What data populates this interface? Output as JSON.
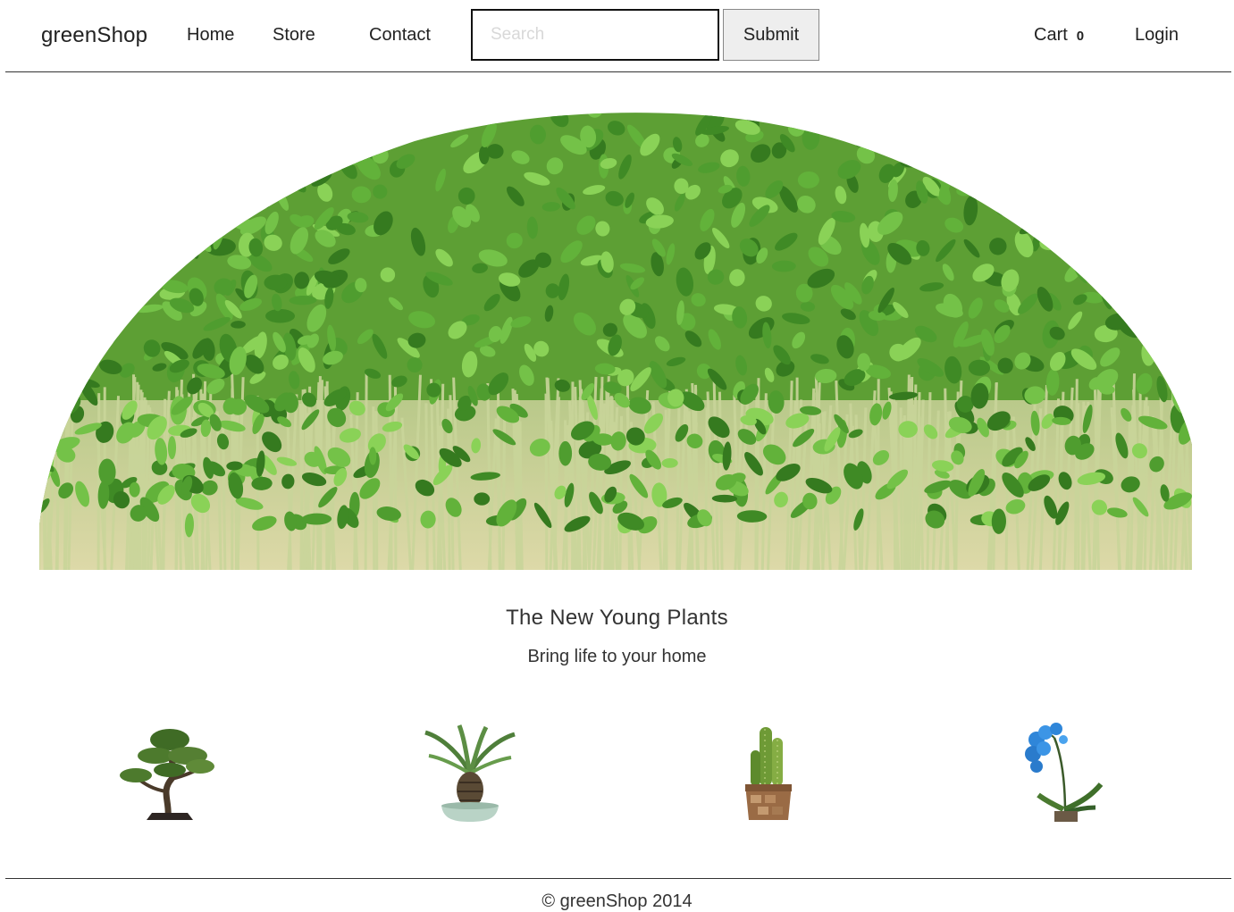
{
  "header": {
    "brand": "greenShop",
    "nav": [
      "Home",
      "Store",
      "Contact"
    ],
    "search_placeholder": "Search",
    "submit_label": "Submit",
    "cart_label": "Cart",
    "cart_count": "0",
    "login_label": "Login"
  },
  "tagline": {
    "title": "The New Young Plants",
    "subtitle": "Bring life to your home"
  },
  "footer": {
    "copyright": "© greenShop 2014"
  },
  "icons": {
    "hero": "cress-sprouts-image",
    "products": [
      "bonsai-tree-icon",
      "cycad-pot-icon",
      "cactus-pot-icon",
      "blue-orchid-icon"
    ]
  },
  "colors": {
    "text": "#222222",
    "border": "#333333",
    "button_bg": "#eeeeee",
    "leaf_green": "#4f9d2f",
    "orchid_blue": "#2f86d9"
  }
}
